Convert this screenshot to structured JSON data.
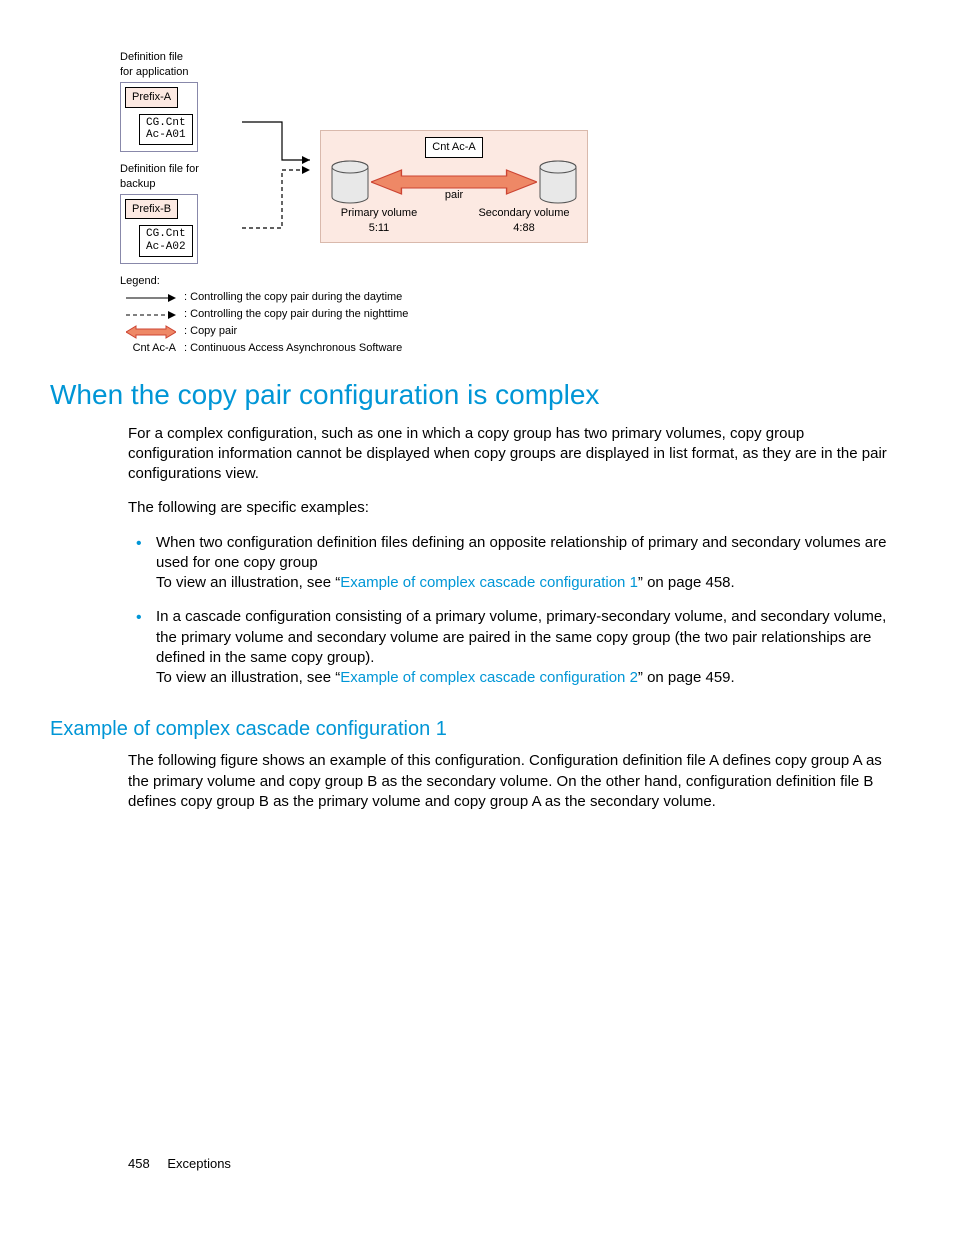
{
  "diagram": {
    "def_app_label": "Definition file\nfor application",
    "def_backup_label": "Definition file for\nbackup",
    "prefix_a": "Prefix-A",
    "prefix_b": "Prefix-B",
    "cg_a": "CG.Cnt\nAc-A01",
    "cg_b": "CG.Cnt\nAc-A02",
    "cnt_box": "Cnt Ac-A",
    "pair": "pair",
    "primary_vol_label": "Primary volume",
    "primary_vol_id": "5:11",
    "secondary_vol_label": "Secondary volume",
    "secondary_vol_id": "4:88",
    "legend_title": "Legend:",
    "legend_day": "Controlling the copy pair during the daytime",
    "legend_night": "Controlling the copy pair during the nighttime",
    "legend_copy": "Copy pair",
    "legend_cnt_sym": "Cnt Ac-A",
    "legend_cnt": "Continuous Access Asynchronous Software"
  },
  "section": {
    "title": "When the copy pair configuration is complex",
    "p1": "For a complex configuration, such as one in which a copy group has two primary volumes, copy group configuration information cannot be displayed when copy groups are displayed in list format, as they are in the pair configurations view.",
    "p2": "The following are specific examples:",
    "bullet1_a": "When two configuration definition files defining an opposite relationship of primary and secondary volumes are used for one copy group",
    "bullet1_b_pre": "To view an illustration, see “",
    "bullet1_b_link": "Example of complex cascade configuration 1",
    "bullet1_b_post": "” on page 458.",
    "bullet2_a": "In a cascade configuration consisting of a primary volume, primary-secondary volume, and secondary volume, the primary volume and secondary volume are paired in the same copy group (the two pair relationships are defined in the same copy group).",
    "bullet2_b_pre": "To view an illustration, see “",
    "bullet2_b_link": "Example of complex cascade configuration 2",
    "bullet2_b_post": "” on page 459."
  },
  "subsection": {
    "title": "Example of complex cascade configuration 1",
    "p1": "The following figure shows an example of this configuration. Configuration definition file A defines copy group A as the primary volume and copy group B as the secondary volume. On the other hand, configuration definition file B defines copy group B as the primary volume and copy group A as the secondary volume."
  },
  "footer": {
    "page": "458",
    "chapter": "Exceptions"
  }
}
